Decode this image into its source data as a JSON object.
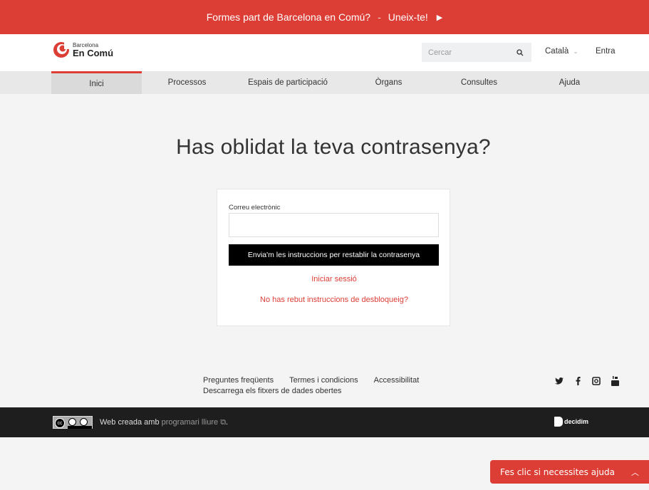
{
  "announcement": {
    "text": "Formes part de Barcelona en Comú?",
    "separator": "-",
    "cta": "Uneix-te!",
    "cta_icon": "▶"
  },
  "header": {
    "logo": {
      "line1": "Barcelona",
      "line2": "En Comú"
    },
    "search_placeholder": "Cercar",
    "language": "Català",
    "signin": "Entra"
  },
  "nav": {
    "items": [
      {
        "label": "Inici"
      },
      {
        "label": "Processos"
      },
      {
        "label": "Espais de participació"
      },
      {
        "label": "Òrgans"
      },
      {
        "label": "Consultes"
      },
      {
        "label": "Ajuda"
      }
    ]
  },
  "page": {
    "title": "Has oblidat la teva contrasenya?",
    "form": {
      "email_label": "Correu electrònic",
      "email_value": "",
      "submit": "Envia'm les instruccions per restablir la contrasenya",
      "login_link": "Iniciar sessió",
      "unlock_link": "No has rebut instruccions de desbloqueig?"
    }
  },
  "footer": {
    "links": [
      "Preguntes freqüents",
      "Termes i condicions",
      "Accessibilitat"
    ],
    "links2": [
      "Descarrega els fitxers de dades obertes"
    ],
    "social": [
      "twitter-icon",
      "facebook-icon",
      "instagram-icon",
      "youtube-icon"
    ],
    "made_with": "Web creada amb",
    "free_software": "programari lliure",
    "period": ".",
    "brand": "decidim"
  },
  "help_widget": {
    "label": "Fes clic si necessites ajuda"
  },
  "colors": {
    "accent": "#dc3e35",
    "dark": "#1e1e1e",
    "nav_bg": "#e8e8e8"
  }
}
